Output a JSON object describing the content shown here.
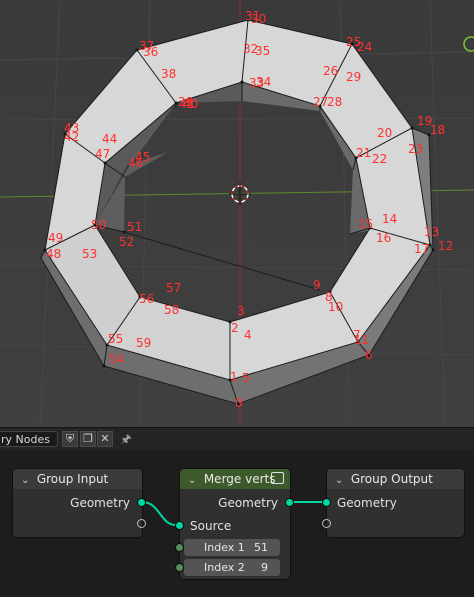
{
  "viewport": {
    "vertex_labels": [
      {
        "text": "31"
      },
      {
        "text": "30"
      },
      {
        "text": "32"
      },
      {
        "text": "35"
      },
      {
        "text": "25"
      },
      {
        "text": "24"
      },
      {
        "text": "37"
      },
      {
        "text": "36"
      },
      {
        "text": "38"
      },
      {
        "text": "39"
      },
      {
        "text": "33"
      },
      {
        "text": "34"
      },
      {
        "text": "26"
      },
      {
        "text": "29"
      },
      {
        "text": "27"
      },
      {
        "text": "28"
      },
      {
        "text": "40"
      },
      {
        "text": "41"
      },
      {
        "text": "43"
      },
      {
        "text": "42"
      },
      {
        "text": "44"
      },
      {
        "text": "47"
      },
      {
        "text": "45"
      },
      {
        "text": "46"
      },
      {
        "text": "19"
      },
      {
        "text": "18"
      },
      {
        "text": "20"
      },
      {
        "text": "23"
      },
      {
        "text": "21"
      },
      {
        "text": "22"
      },
      {
        "text": "50"
      },
      {
        "text": "51"
      },
      {
        "text": "49"
      },
      {
        "text": "52"
      },
      {
        "text": "48"
      },
      {
        "text": "53"
      },
      {
        "text": "15"
      },
      {
        "text": "14"
      },
      {
        "text": "16"
      },
      {
        "text": "13"
      },
      {
        "text": "12"
      },
      {
        "text": "17"
      },
      {
        "text": "9"
      },
      {
        "text": "8"
      },
      {
        "text": "10"
      },
      {
        "text": "57"
      },
      {
        "text": "56"
      },
      {
        "text": "58"
      },
      {
        "text": "3"
      },
      {
        "text": "2"
      },
      {
        "text": "4"
      },
      {
        "text": "55"
      },
      {
        "text": "59"
      },
      {
        "text": "54"
      },
      {
        "text": "7"
      },
      {
        "text": "11"
      },
      {
        "text": "6"
      },
      {
        "text": "1"
      },
      {
        "text": "5"
      },
      {
        "text": "0"
      }
    ]
  },
  "node_editor": {
    "header": {
      "tree_name": "ry Nodes",
      "fake_user_icon": "shield-icon",
      "duplicate_icon": "duplicate-icon",
      "close_icon": "close-icon",
      "pin_icon": "pin-icon"
    },
    "nodes": {
      "group_input": {
        "title": "Group Input",
        "output_label": "Geometry"
      },
      "merge_verts": {
        "title": "Merge verts",
        "output_label": "Geometry",
        "source_label": "Source",
        "index1_label": "Index 1",
        "index1_value": "51",
        "index2_label": "Index 2",
        "index2_value": "9"
      },
      "group_output": {
        "title": "Group Output",
        "input_label": "Geometry"
      }
    },
    "colors": {
      "geometry_socket": "#00d6a3",
      "int_socket": "#598c5c",
      "group_header": "#3b3b3b",
      "merge_header": "#3d5a2c",
      "vertex_label": "#ff3030"
    }
  }
}
